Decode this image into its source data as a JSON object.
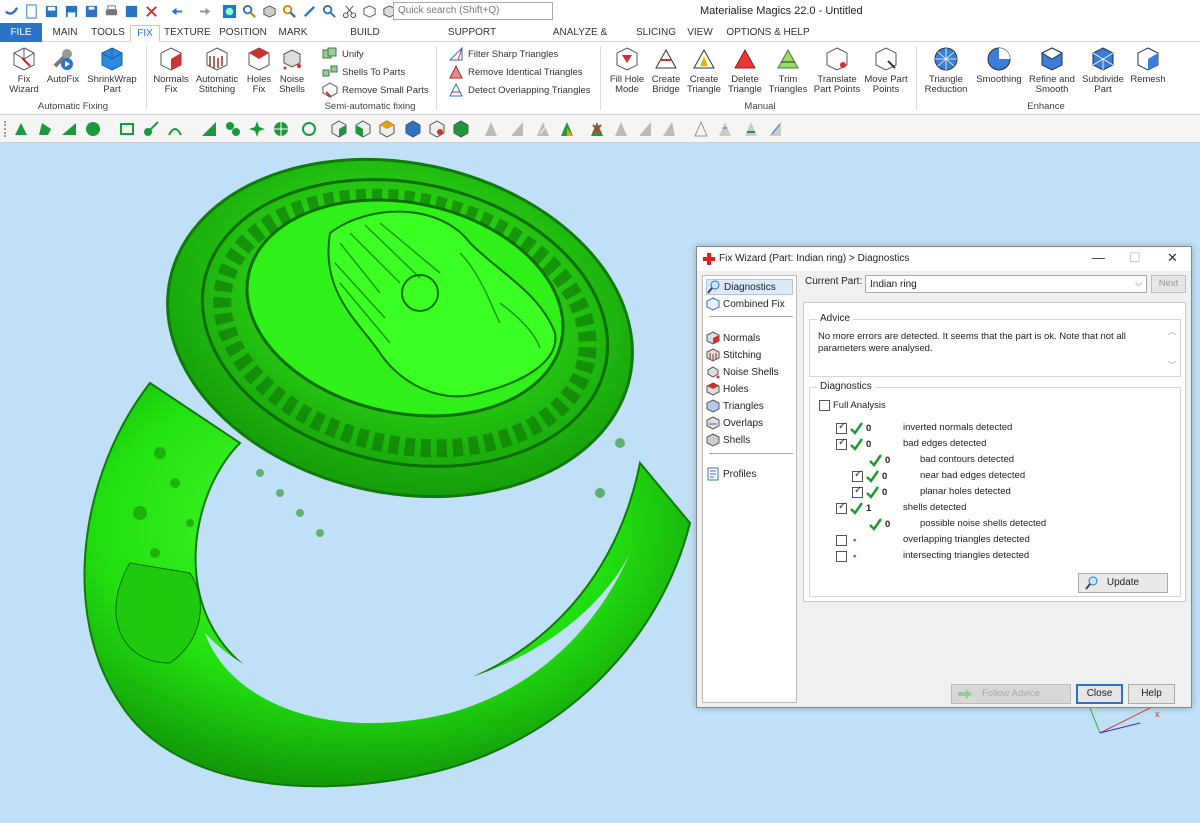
{
  "app": {
    "title": "Materialise Magics 22.0 - Untitled",
    "search_placeholder": "Quick search (Shift+Q)"
  },
  "tabs": [
    "FILE",
    "MAIN",
    "TOOLS",
    "FIX",
    "TEXTURE",
    "POSITION",
    "MARK",
    "BUILD PREPARATION",
    "SUPPORT GENERATION",
    "ANALYZE & REPORT",
    "SLICING",
    "VIEW",
    "OPTIONS & HELP"
  ],
  "active_tab": "FIX",
  "ribbon": {
    "groups": {
      "automatic_fixing": "Automatic Fixing",
      "semi_automatic": "Semi-automatic fixing",
      "manual": "Manual",
      "enhance": "Enhance"
    },
    "buttons": {
      "fix_wizard": [
        "Fix",
        "Wizard"
      ],
      "autofix": [
        "AutoFix"
      ],
      "shrinkwrap": [
        "ShrinkWrap",
        "Part"
      ],
      "normals_fix": [
        "Normals",
        "Fix"
      ],
      "auto_stitching": [
        "Automatic",
        "Stitching"
      ],
      "holes_fix": [
        "Holes",
        "Fix"
      ],
      "noise_shells": [
        "Noise",
        "Shells"
      ],
      "fill_hole_mode": [
        "Fill Hole",
        "Mode"
      ],
      "create_bridge": [
        "Create",
        "Bridge"
      ],
      "create_triangle": [
        "Create",
        "Triangle"
      ],
      "delete_triangle": [
        "Delete",
        "Triangle"
      ],
      "trim_triangles": [
        "Trim",
        "Triangles"
      ],
      "translate_part_points": [
        "Translate",
        "Part Points"
      ],
      "move_part_points": [
        "Move Part",
        "Points"
      ],
      "triangle_reduction": [
        "Triangle",
        "Reduction"
      ],
      "smoothing": [
        "Smoothing"
      ],
      "refine_smooth": [
        "Refine and",
        "Smooth"
      ],
      "subdivide_part": [
        "Subdivide",
        "Part"
      ],
      "remesh": [
        "Remesh"
      ]
    },
    "small": {
      "unify": "Unify",
      "shells_to_parts": "Shells To Parts",
      "remove_small_parts": "Remove Small Parts",
      "filter_sharp": "Filter Sharp Triangles",
      "remove_identical": "Remove Identical Triangles",
      "detect_overlapping": "Detect Overlapping Triangles"
    }
  },
  "dialog": {
    "title": "Fix Wizard (Part: Indian ring) > Diagnostics",
    "nav": [
      "Diagnostics",
      "Combined Fix",
      "Normals",
      "Stitching",
      "Noise Shells",
      "Holes",
      "Triangles",
      "Overlaps",
      "Shells",
      "Profiles"
    ],
    "current_part_label": "Current Part:",
    "current_part_value": "Indian ring",
    "next": "Next",
    "advice_legend": "Advice",
    "advice_text": "No more errors are detected. It seems that the part is ok. Note that not all parameters were analysed.",
    "diagnostics_legend": "Diagnostics",
    "full_analysis": "Full Analysis",
    "rows": [
      {
        "value": "0",
        "label": "inverted normals detected"
      },
      {
        "value": "0",
        "label": "bad edges detected"
      },
      {
        "value": "0",
        "label": "bad contours detected"
      },
      {
        "value": "0",
        "label": "near bad edges detected"
      },
      {
        "value": "0",
        "label": "planar holes detected"
      },
      {
        "value": "1",
        "label": "shells detected"
      },
      {
        "value": "0",
        "label": "possible noise shells detected"
      },
      {
        "value": "•",
        "label": "overlapping triangles detected"
      },
      {
        "value": "•",
        "label": "intersecting triangles detected"
      }
    ],
    "update": "Update",
    "follow_advice": "Follow Advice",
    "close": "Close",
    "help": "Help"
  },
  "colors": {
    "accent": "#2a73c5",
    "part_green": "#22e010",
    "viewport_bg": "#bfe0f6",
    "check_green": "#1f9a2a"
  }
}
